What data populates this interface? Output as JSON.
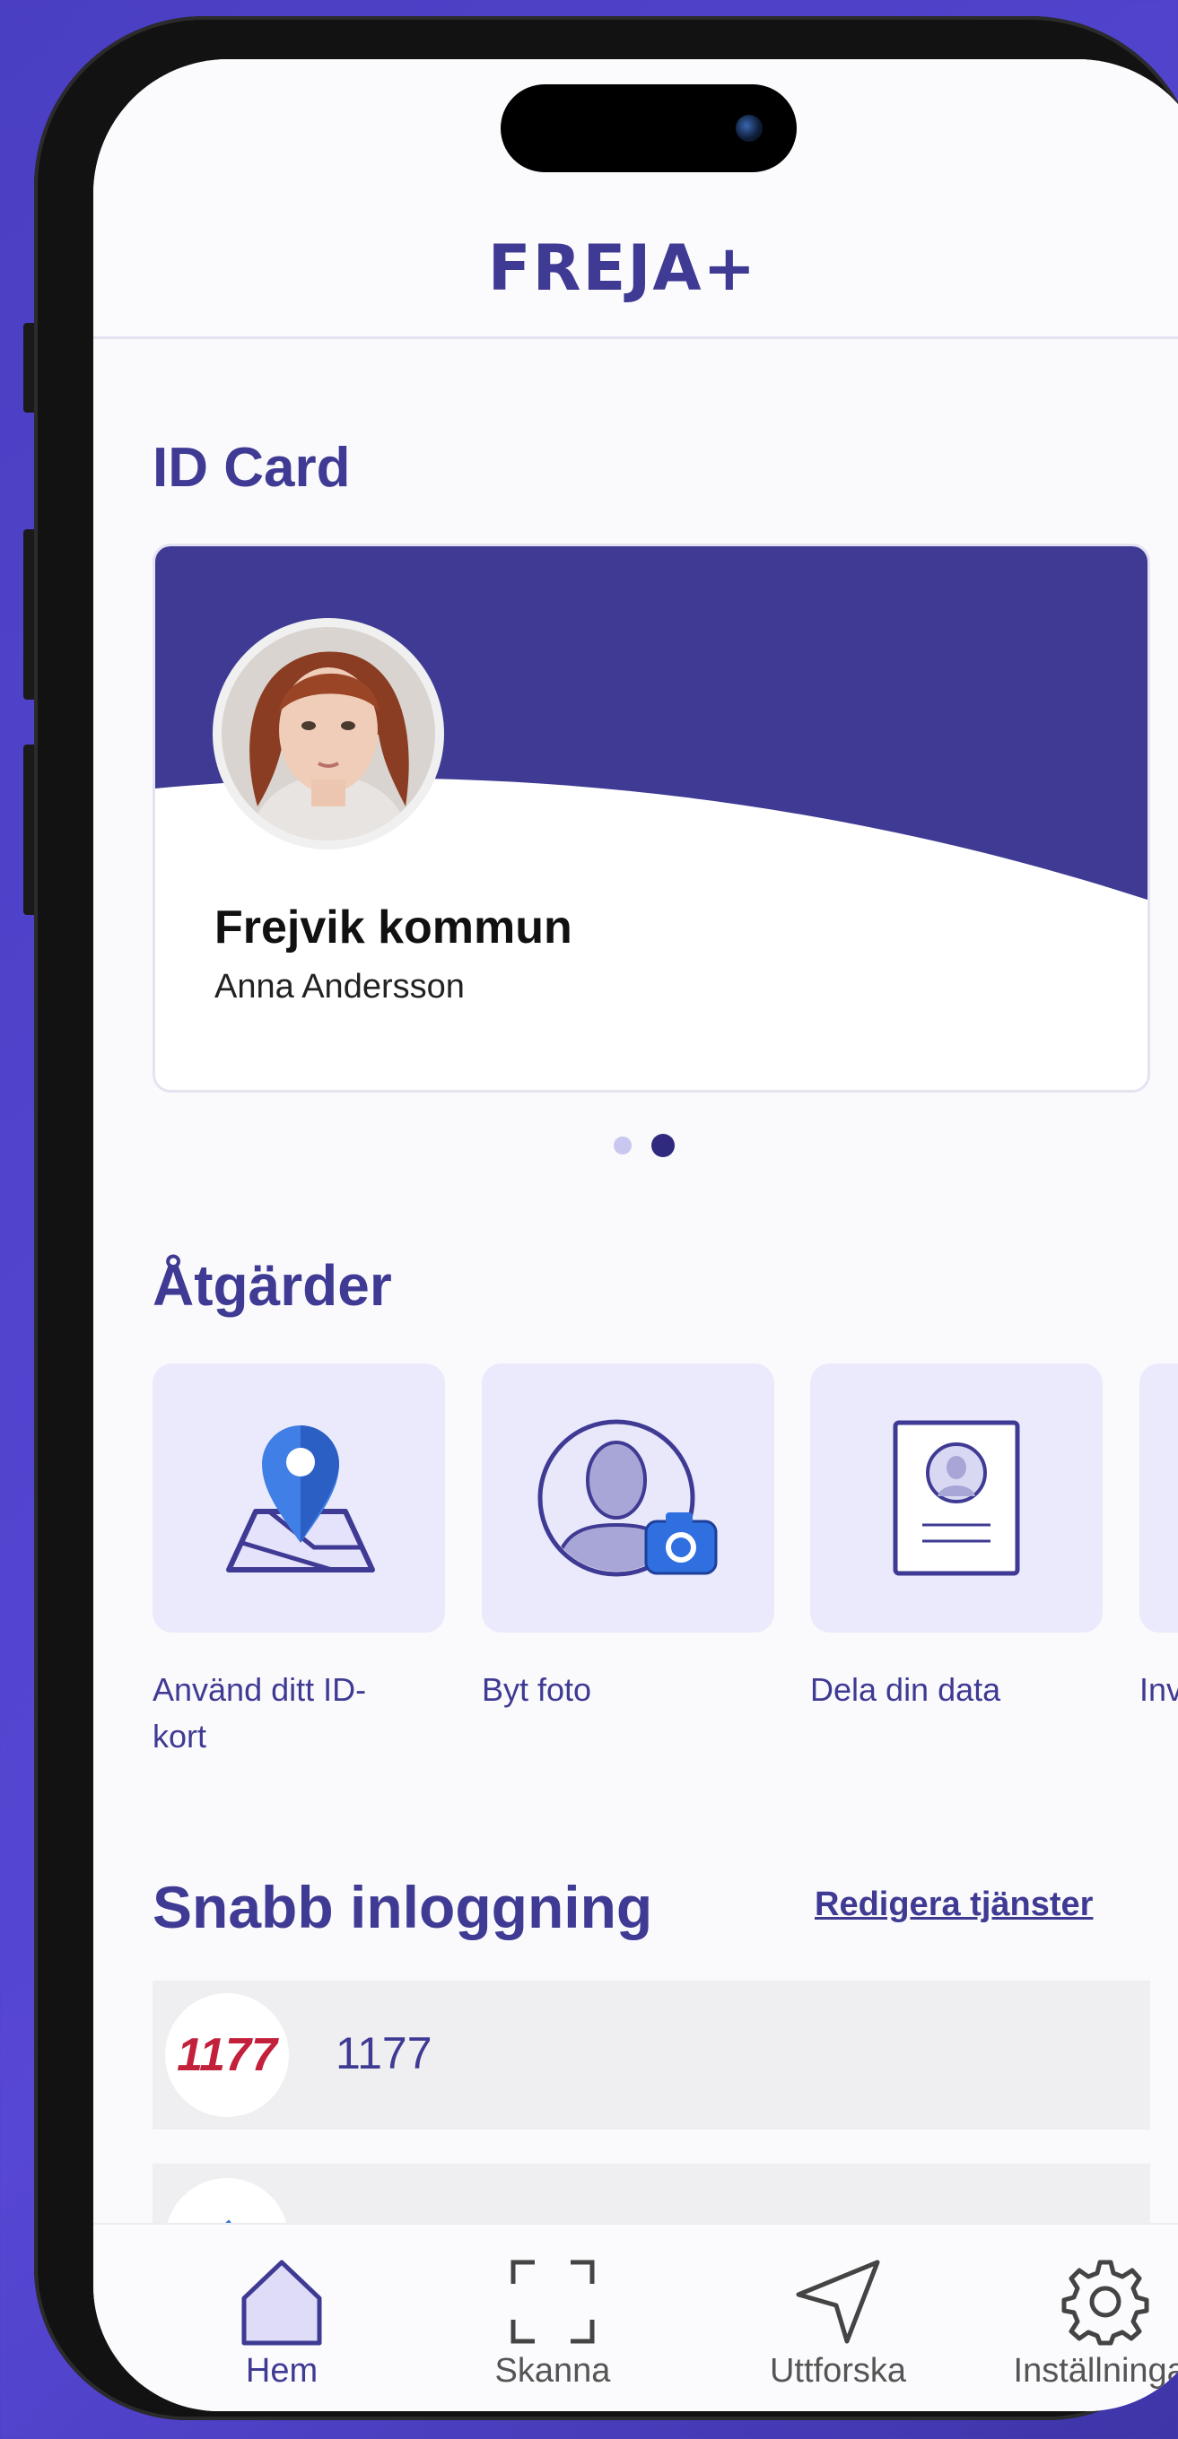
{
  "app": {
    "logo_text": "FREJA+",
    "accent": "#3f3a93"
  },
  "id_card": {
    "section_title": "ID Card",
    "organization": "Frejvik kommun",
    "holder_name": "Anna Andersson",
    "pager": {
      "count": 2,
      "active_index": 1
    }
  },
  "actions": {
    "section_title": "Åtgärder",
    "items": [
      {
        "label": "Använd ditt ID-kort",
        "label_line1": "Använd ditt ID-",
        "label_line2": "kort",
        "icon": "map-pin-icon"
      },
      {
        "label": "Byt foto",
        "icon": "change-photo-icon"
      },
      {
        "label": "Dela din data",
        "icon": "id-document-icon"
      },
      {
        "label": "Invit",
        "icon": "invite-icon"
      }
    ]
  },
  "quick_login": {
    "section_title": "Snabb inloggning",
    "edit_link": "Redigera tjänster",
    "services": [
      {
        "logo_text": "1177",
        "name": "1177"
      }
    ]
  },
  "tabbar": {
    "items": [
      {
        "label": "Hem",
        "icon": "home-icon",
        "active": true
      },
      {
        "label": "Skanna",
        "icon": "scan-icon",
        "active": false
      },
      {
        "label": "Uttforska",
        "icon": "navigation-arrow-icon",
        "active": false
      },
      {
        "label": "Inställningar",
        "icon": "gear-icon",
        "active": false
      }
    ]
  }
}
